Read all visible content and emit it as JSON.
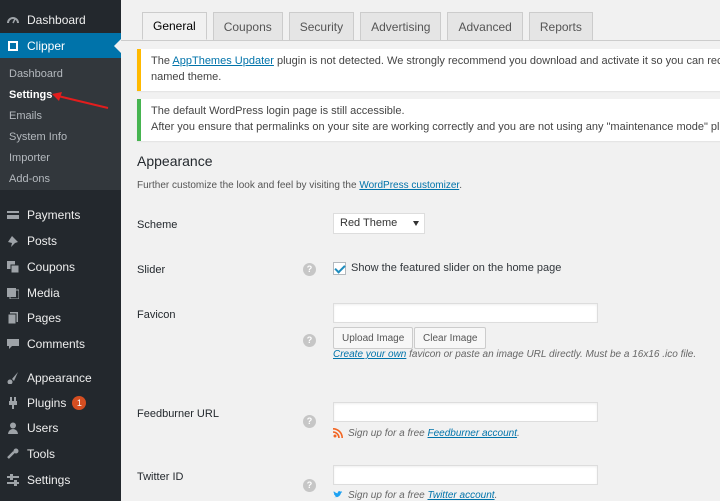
{
  "sidebar": {
    "top_items": [
      {
        "label": "Dashboard",
        "icon": "dashboard-icon"
      },
      {
        "label": "Clipper",
        "icon": "clipper-icon"
      }
    ],
    "submenu": [
      "Dashboard",
      "Settings",
      "Emails",
      "System Info",
      "Importer",
      "Add-ons"
    ],
    "items": [
      {
        "label": "Payments",
        "icon": "payments-icon"
      },
      {
        "label": "Posts",
        "icon": "pushpin-icon"
      },
      {
        "label": "Coupons",
        "icon": "coupons-icon"
      },
      {
        "label": "Media",
        "icon": "media-icon"
      },
      {
        "label": "Pages",
        "icon": "pages-icon"
      },
      {
        "label": "Comments",
        "icon": "comments-icon"
      },
      {
        "label": "Appearance",
        "icon": "paintbrush-icon"
      },
      {
        "label": "Plugins",
        "icon": "plugins-icon",
        "badge": "1"
      },
      {
        "label": "Users",
        "icon": "users-icon"
      },
      {
        "label": "Tools",
        "icon": "wrench-icon"
      },
      {
        "label": "Settings",
        "icon": "settings-icon"
      }
    ]
  },
  "tabs": [
    "General",
    "Coupons",
    "Security",
    "Advertising",
    "Advanced",
    "Reports"
  ],
  "notices": {
    "updater_pre": "The ",
    "updater_link": "AppThemes Updater",
    "updater_post": " plugin is not detected. We strongly recommend you download and activate it so you can receive the latest",
    "updater_line2": "named theme.",
    "login_line1": "The default WordPress login page is still accessible.",
    "login_line2": "After you ensure that permalinks on your site are working correctly and you are not using any \"maintenance mode\" plugins, please o"
  },
  "section": {
    "title": "Appearance",
    "desc_pre": "Further customize the look and feel by visiting the ",
    "desc_link": "WordPress customizer",
    "desc_post": "."
  },
  "fields": {
    "scheme_label": "Scheme",
    "scheme_value": "Red Theme",
    "slider_label": "Slider",
    "slider_checkbox": "Show the featured slider on the home page",
    "favicon_label": "Favicon",
    "upload_button": "Upload Image",
    "clear_button": "Clear Image",
    "favicon_hint_link": "Create your own",
    "favicon_hint_rest": " favicon or paste an image URL directly. Must be a 16x16 .ico file.",
    "feedburner_label": "Feedburner URL",
    "feedburner_hint_pre": "Sign up for a free ",
    "feedburner_hint_link": "Feedburner account",
    "feedburner_hint_post": ".",
    "twitter_label": "Twitter ID",
    "twitter_hint_pre": "Sign up for a free ",
    "twitter_hint_link": "Twitter account",
    "twitter_hint_post": "."
  },
  "colors": {
    "sidebar": "#23282d",
    "accent": "#0073aa",
    "warning": "#ffb900",
    "success": "#46b450",
    "annotation_arrow": "#e21d1d"
  }
}
